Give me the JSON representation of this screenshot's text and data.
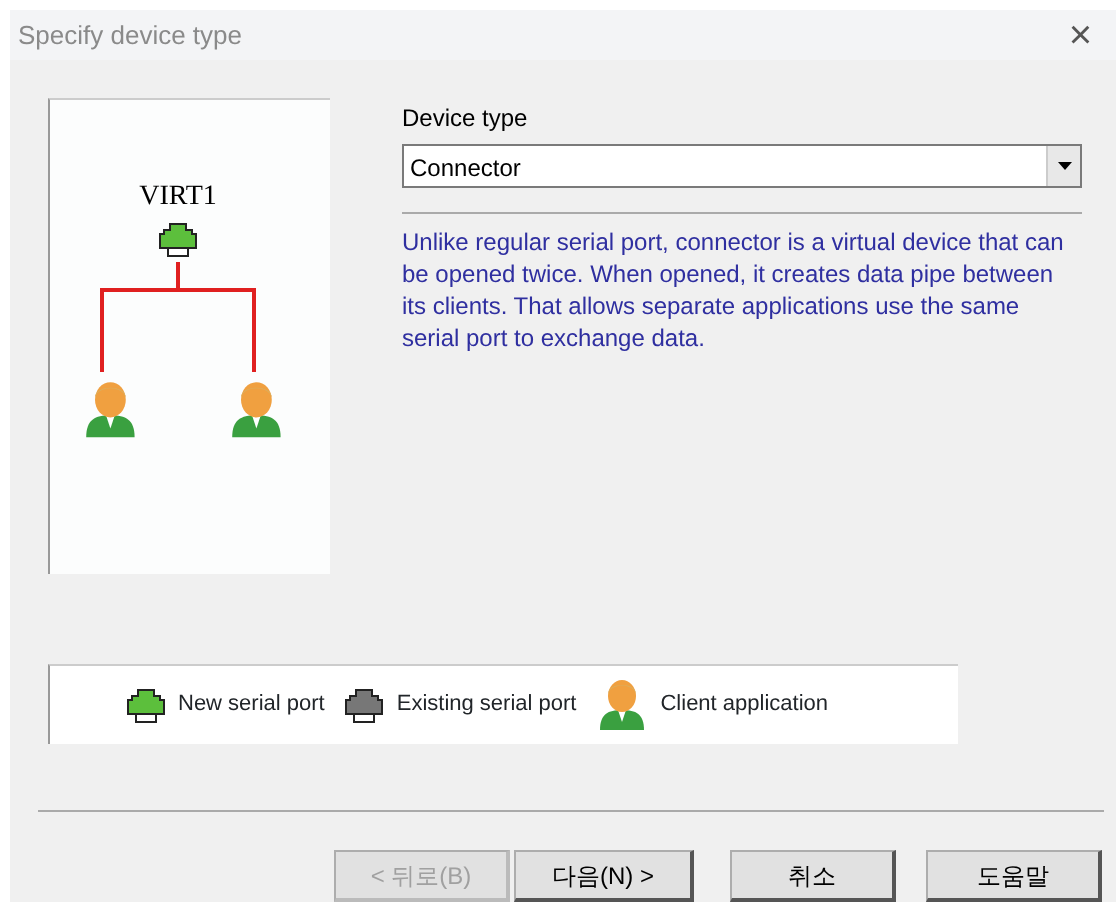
{
  "window": {
    "title": "Specify device type",
    "close": "×"
  },
  "diagram": {
    "node_label": "VIRT1"
  },
  "device_type": {
    "label": "Device type",
    "value": "Connector"
  },
  "description": "Unlike regular serial port, connector is a virtual device that can be opened twice. When opened, it creates data pipe between its clients. That allows separate applications use the same serial port to exchange data.",
  "legend": [
    {
      "kind": "new_port",
      "label": "New serial port"
    },
    {
      "kind": "existing_port",
      "label": "Existing serial port"
    },
    {
      "kind": "client",
      "label": "Client application"
    }
  ],
  "buttons": [
    {
      "label": "< 뒤로(B)",
      "disabled": true
    },
    {
      "label": "다음(N) >",
      "disabled": false
    },
    {
      "label": "취소",
      "disabled": false
    },
    {
      "label": "도움말",
      "disabled": false
    }
  ]
}
